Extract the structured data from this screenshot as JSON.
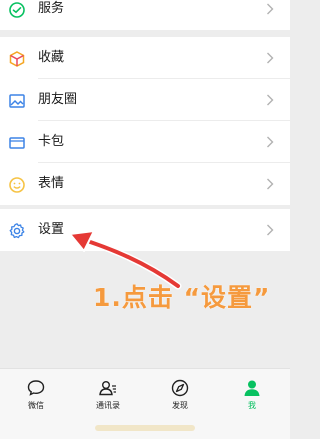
{
  "menu": {
    "services": "服务",
    "favorites": "收藏",
    "moments": "朋友圈",
    "cards": "卡包",
    "stickers": "表情",
    "settings": "设置"
  },
  "annotation": {
    "text": "1.点击 “设置”",
    "color": "#f59a3e"
  },
  "tabbar": {
    "items": [
      {
        "label": "微信",
        "icon": "chat-icon"
      },
      {
        "label": "通讯录",
        "icon": "contacts-icon"
      },
      {
        "label": "发现",
        "icon": "compass-icon"
      },
      {
        "label": "我",
        "icon": "person-icon"
      }
    ],
    "active_color": "#07c160"
  },
  "icon_colors": {
    "services": "#07c160",
    "favorites": "#f5a623",
    "moments": "#3d84e6",
    "cards": "#3d84e6",
    "stickers": "#f6c344",
    "settings": "#3d84e6"
  }
}
